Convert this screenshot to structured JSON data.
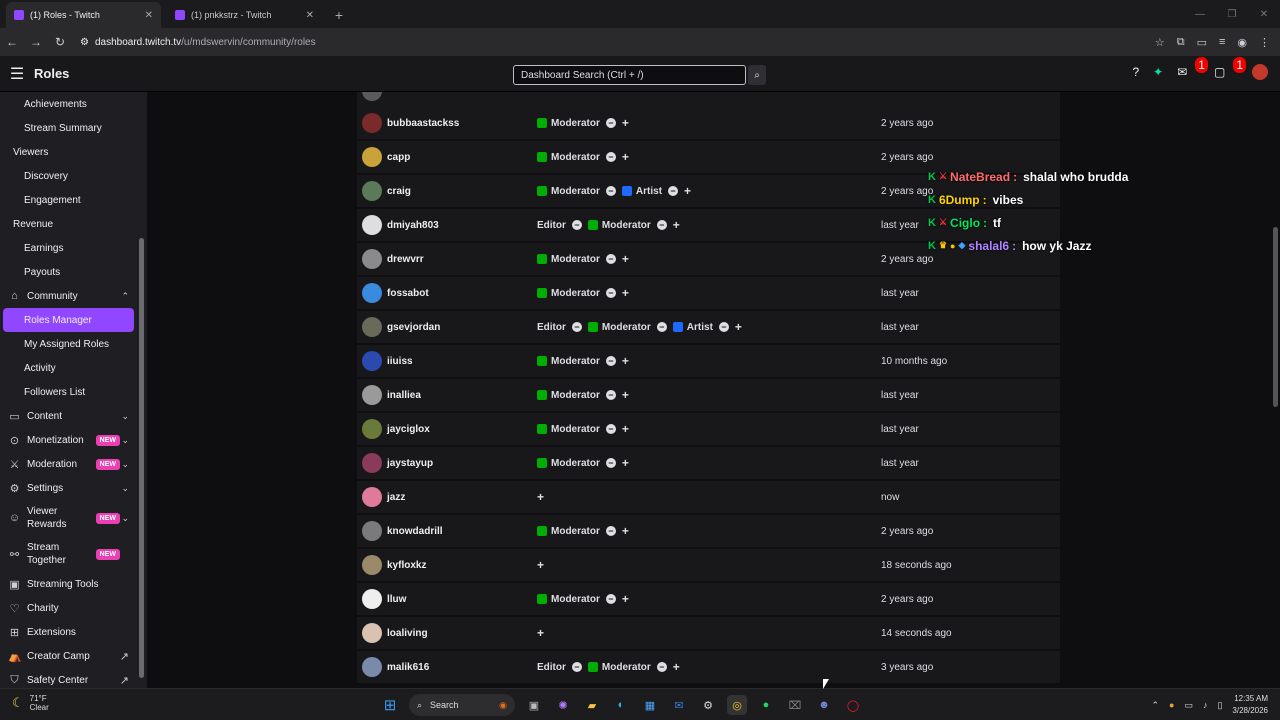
{
  "browser": {
    "tabs": [
      {
        "title": "(1) Roles - Twitch",
        "active": true
      },
      {
        "title": "(1) pnkkstrz - Twitch",
        "active": false
      }
    ],
    "url_host": "dashboard.twitch.tv",
    "url_path": "/u/mdswervin/community/roles"
  },
  "topbar": {
    "title": "Roles",
    "search_placeholder": "Dashboard Search (Ctrl + /)",
    "notif_badge_1": "1",
    "notif_badge_2": "1"
  },
  "sidebar": {
    "items": [
      {
        "label": "Achievements",
        "kind": "sub"
      },
      {
        "label": "Stream Summary",
        "kind": "sub"
      },
      {
        "label": "Viewers",
        "kind": "head"
      },
      {
        "label": "Discovery",
        "kind": "sub"
      },
      {
        "label": "Engagement",
        "kind": "sub"
      },
      {
        "label": "Revenue",
        "kind": "head"
      },
      {
        "label": "Earnings",
        "kind": "sub"
      },
      {
        "label": "Payouts",
        "kind": "sub"
      },
      {
        "label": "Community",
        "kind": "top",
        "icon": "community-icon",
        "chevron": "up"
      },
      {
        "label": "Roles Manager",
        "kind": "active"
      },
      {
        "label": "My Assigned Roles",
        "kind": "sub"
      },
      {
        "label": "Activity",
        "kind": "sub"
      },
      {
        "label": "Followers List",
        "kind": "sub"
      },
      {
        "label": "Content",
        "kind": "top",
        "icon": "content-icon",
        "chevron": "down"
      },
      {
        "label": "Monetization",
        "kind": "top",
        "icon": "monetization-icon",
        "chevron": "down",
        "badge": "NEW"
      },
      {
        "label": "Moderation",
        "kind": "top",
        "icon": "moderation-icon",
        "chevron": "down",
        "badge": "NEW"
      },
      {
        "label": "Settings",
        "kind": "top",
        "icon": "settings-icon",
        "chevron": "down"
      },
      {
        "label": "Viewer\nRewards",
        "kind": "top-tall",
        "icon": "viewer-rewards-icon",
        "chevron": "down",
        "badge": "NEW"
      },
      {
        "label": "Stream\nTogether",
        "kind": "top-tall",
        "icon": "stream-together-icon",
        "badge": "NEW"
      },
      {
        "label": "Streaming Tools",
        "kind": "top",
        "icon": "streaming-tools-icon"
      },
      {
        "label": "Charity",
        "kind": "top",
        "icon": "charity-icon"
      },
      {
        "label": "Extensions",
        "kind": "top",
        "icon": "extensions-icon"
      },
      {
        "label": "Creator Camp",
        "kind": "top",
        "icon": "creator-camp-icon",
        "external": true
      },
      {
        "label": "Safety Center",
        "kind": "top",
        "icon": "safety-center-icon",
        "external": true
      }
    ]
  },
  "rows": [
    {
      "name": "bubbaastackss",
      "roles": [
        "Moderator"
      ],
      "added": "2 years ago",
      "avatar": "#7a2a2a"
    },
    {
      "name": "capp",
      "roles": [
        "Moderator"
      ],
      "added": "2 years ago",
      "avatar": "#c9a33a"
    },
    {
      "name": "craig",
      "roles": [
        "Moderator",
        "Artist"
      ],
      "added": "2 years ago",
      "avatar": "#5a7a5a"
    },
    {
      "name": "dmiyah803",
      "roles": [
        "Editor",
        "Moderator"
      ],
      "added": "last year",
      "avatar": "#dedede"
    },
    {
      "name": "drewvrr",
      "roles": [
        "Moderator"
      ],
      "added": "2 years ago",
      "avatar": "#8a8a8a"
    },
    {
      "name": "fossabot",
      "roles": [
        "Moderator"
      ],
      "added": "last year",
      "avatar": "#3a8ae0"
    },
    {
      "name": "gsevjordan",
      "roles": [
        "Editor",
        "Moderator",
        "Artist"
      ],
      "added": "last year",
      "avatar": "#6a6a5a"
    },
    {
      "name": "iiuiss",
      "roles": [
        "Moderator"
      ],
      "added": "10 months ago",
      "avatar": "#2a4ab0"
    },
    {
      "name": "inalliea",
      "roles": [
        "Moderator"
      ],
      "added": "last year",
      "avatar": "#9a9a9a"
    },
    {
      "name": "jayciglox",
      "roles": [
        "Moderator"
      ],
      "added": "last year",
      "avatar": "#6a7a3a"
    },
    {
      "name": "jaystayup",
      "roles": [
        "Moderator"
      ],
      "added": "last year",
      "avatar": "#8a3a5a"
    },
    {
      "name": "jazz",
      "roles": [],
      "added": "now",
      "avatar": "#e07a9a"
    },
    {
      "name": "knowdadrill",
      "roles": [
        "Moderator"
      ],
      "added": "2 years ago",
      "avatar": "#7a7a7a"
    },
    {
      "name": "kyfloxkz",
      "roles": [],
      "added": "18 seconds ago",
      "avatar": "#9a8a6a"
    },
    {
      "name": "lluw",
      "roles": [
        "Moderator"
      ],
      "added": "2 years ago",
      "avatar": "#eeeeee"
    },
    {
      "name": "loaliving",
      "roles": [],
      "added": "14 seconds ago",
      "avatar": "#d9c3b0"
    },
    {
      "name": "malik616",
      "roles": [
        "Editor",
        "Moderator"
      ],
      "added": "3 years ago",
      "avatar": "#7a8aaa"
    }
  ],
  "chat_overlay": [
    {
      "user": "NateBread",
      "message": "shalal who brudda",
      "color": "#ff6b6b"
    },
    {
      "user": "6Dump",
      "message": "vibes",
      "color": "#ffd400"
    },
    {
      "user": "Ciglo",
      "message": "tf",
      "color": "#00e65c"
    },
    {
      "user": "shalal6",
      "message": "how yk Jazz",
      "color": "#b084ff"
    }
  ],
  "taskbar": {
    "temperature": "71°F",
    "condition": "Clear",
    "search_label": "Search",
    "time": "12:35 AM",
    "date": "3/28/2026"
  }
}
